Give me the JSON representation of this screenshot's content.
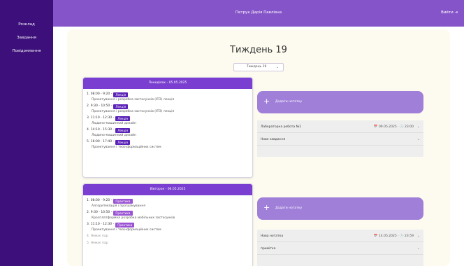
{
  "sidebar": {
    "items": [
      {
        "label": "Розклад"
      },
      {
        "label": "Завдання"
      },
      {
        "label": "Повідомлення"
      }
    ]
  },
  "topbar": {
    "user": "Петрук Дарія Павлівна",
    "logout": "Вийти ⇥"
  },
  "page": {
    "title": "Тиждень 19",
    "week_select": "Тиждень 19"
  },
  "days": [
    {
      "header": "Понеділок - 05.05.2025",
      "lessons": [
        {
          "time": "1. 08:00 - 9:20 -",
          "type": "Лекція",
          "subject": "Проектування і розробка застосунків (ІПЗ) лекція"
        },
        {
          "time": "2. 9:30 - 10:50 -",
          "type": "Лекція",
          "subject": "Проектування і розробка застосунків (ІПЗ) лекція"
        },
        {
          "time": "3. 11:10 - 12:30 -",
          "type": "Лекція",
          "subject": "Людино-машинний дизайн"
        },
        {
          "time": "4. 14:10 - 15:30 -",
          "type": "Лекція",
          "subject": "Людино-машинний дизайн"
        },
        {
          "time": "5. 16:00 - 17:40 -",
          "type": "Лекція",
          "subject": "Проектування і теоінформаційних систем"
        }
      ],
      "notes": {
        "add_label": "Додати нотатку",
        "items": [
          {
            "title": "Лабораторна робота №1",
            "meta": "📅 09.05.2025 · 🕓 23:00",
            "chevron": "⌄"
          },
          {
            "title": "Нове завдання",
            "meta": "",
            "chevron": "⌄"
          }
        ]
      }
    },
    {
      "header": "Вівторок - 06.05.2025",
      "lessons": [
        {
          "time": "1. 08:00 - 9:20 -",
          "type": "Практика",
          "subject": "Алгоритмізація і програмування"
        },
        {
          "time": "2. 9:30 - 10:50 -",
          "type": "Практика",
          "subject": "Кросплатформна розробка мобільних застосунків"
        },
        {
          "time": "3. 11:10 - 12:30 -",
          "type": "Практика",
          "subject": "Проектування і теоінформаційних систем"
        }
      ],
      "empty": [
        "4. Немає пар",
        "5. Немає пар"
      ],
      "notes": {
        "add_label": "Додати нотатку",
        "items": [
          {
            "title": "Нова нотатка",
            "meta": "📅 14.05.2025 · 🕓 23:59",
            "chevron": "⌄"
          },
          {
            "title": "примітка",
            "meta": "",
            "chevron": "⌄"
          }
        ]
      }
    }
  ],
  "colors": {
    "sidebar": "#3c0f7a",
    "topbar": "#8654c9",
    "day_header": "#7a3fd0",
    "lecture_badge": "#5b22b8",
    "practice_badge": "#9a53d3",
    "add_note": "#a07fd9"
  }
}
